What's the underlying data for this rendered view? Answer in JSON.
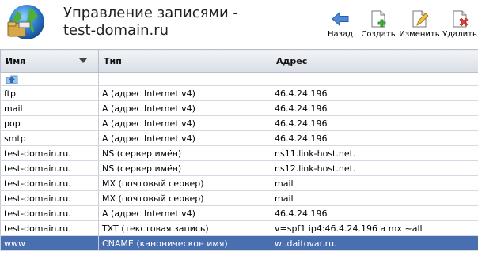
{
  "header": {
    "title_line1": "Управление записями -",
    "title_line2": "test-domain.ru"
  },
  "toolbar": [
    {
      "label": "Назад",
      "icon": "back-arrow-icon"
    },
    {
      "label": "Создать",
      "icon": "create-icon"
    },
    {
      "label": "Изменить",
      "icon": "edit-icon"
    },
    {
      "label": "Удалить",
      "icon": "delete-icon"
    }
  ],
  "table": {
    "columns": [
      "Имя",
      "Тип",
      "Адрес"
    ],
    "rows": [
      {
        "name": "ftp",
        "type": "A (адрес Internet v4)",
        "address": "46.4.24.196"
      },
      {
        "name": "mail",
        "type": "A (адрес Internet v4)",
        "address": "46.4.24.196"
      },
      {
        "name": "pop",
        "type": "A (адрес Internet v4)",
        "address": "46.4.24.196"
      },
      {
        "name": "smtp",
        "type": "A (адрес Internet v4)",
        "address": "46.4.24.196"
      },
      {
        "name": "test-domain.ru.",
        "type": "NS (сервер имён)",
        "address": "ns11.link-host.net."
      },
      {
        "name": "test-domain.ru.",
        "type": "NS (сервер имён)",
        "address": "ns12.link-host.net."
      },
      {
        "name": "test-domain.ru.",
        "type": "MX (почтовый сервер)",
        "address": "mail"
      },
      {
        "name": "test-domain.ru.",
        "type": "MX (почтовый сервер)",
        "address": "mail"
      },
      {
        "name": "test-domain.ru.",
        "type": "A (адрес Internet v4)",
        "address": "46.4.24.196"
      },
      {
        "name": "test-domain.ru.",
        "type": "TXT (текстовая запись)",
        "address": "v=spf1 ip4:46.4.24.196 a mx ~all"
      },
      {
        "name": "www",
        "type": "CNAME (каноническое имя)",
        "address": "wl.daitovar.ru."
      }
    ],
    "selected_row_index": 10
  },
  "colors": {
    "selected_row": "#4a6fb1",
    "header_bg": "#dde2ea"
  }
}
